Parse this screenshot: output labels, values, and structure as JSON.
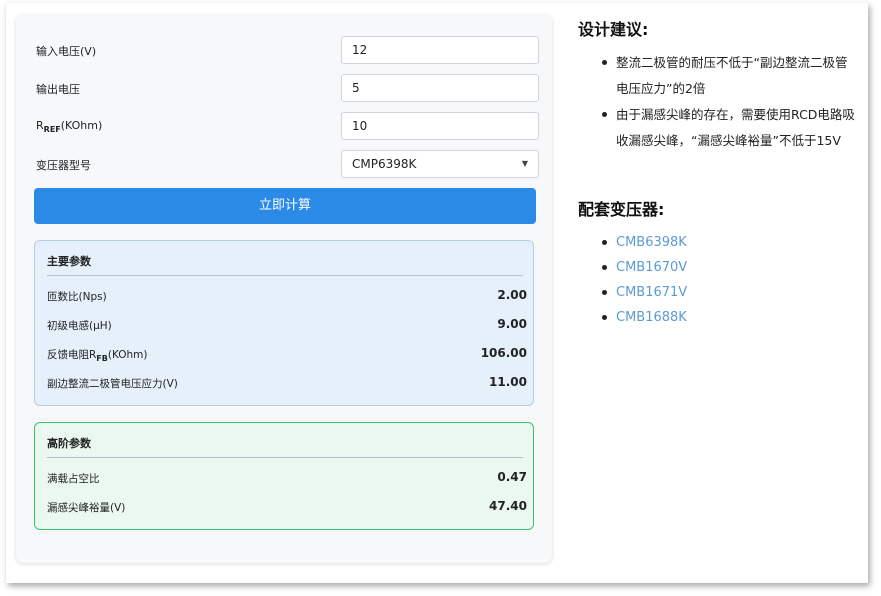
{
  "form": {
    "fields": [
      {
        "label": "输入电压(V)",
        "value": "12"
      },
      {
        "label": "输出电压",
        "value": "5"
      },
      {
        "label_main": "R",
        "label_sub": "REF",
        "label_rest": "(KOhm)",
        "value": "10"
      },
      {
        "label": "变压器型号",
        "value": "CMP6398K"
      }
    ],
    "calculate_label": "立即计算"
  },
  "main_params": {
    "title": "主要参数",
    "rows": [
      {
        "label": "匝数比(Nps)",
        "value": "2.00"
      },
      {
        "label": "初级电感(μH)",
        "value": "9.00"
      },
      {
        "label_main": "反馈电阻R",
        "label_sub": "FB",
        "label_rest": "(KOhm)",
        "value": "106.00"
      },
      {
        "label": "副边整流二极管电压应力(V)",
        "value": "11.00"
      }
    ]
  },
  "advanced_params": {
    "title": "高阶参数",
    "rows": [
      {
        "label": "满载占空比",
        "value": "0.47"
      },
      {
        "label": "漏感尖峰裕量(V)",
        "value": "47.40"
      }
    ]
  },
  "advice": {
    "title": "设计建议:",
    "items": [
      "整流二极管的耐压不低于“副边整流二极管电压应力”的2倍",
      "由于漏感尖峰的存在，需要使用RCD电路吸收漏感尖峰，“漏感尖峰裕量”不低于15V"
    ]
  },
  "transformers": {
    "title": "配套变压器:",
    "items": [
      "CMB6398K",
      "CMB1670V",
      "CMB1671V",
      "CMB1688K"
    ],
    "link_color": "#5b9bd5"
  },
  "colors": {
    "button": "#2a8ae6",
    "main_panel_bg": "#e5f0fa",
    "advanced_panel_border": "#3cc46a"
  }
}
